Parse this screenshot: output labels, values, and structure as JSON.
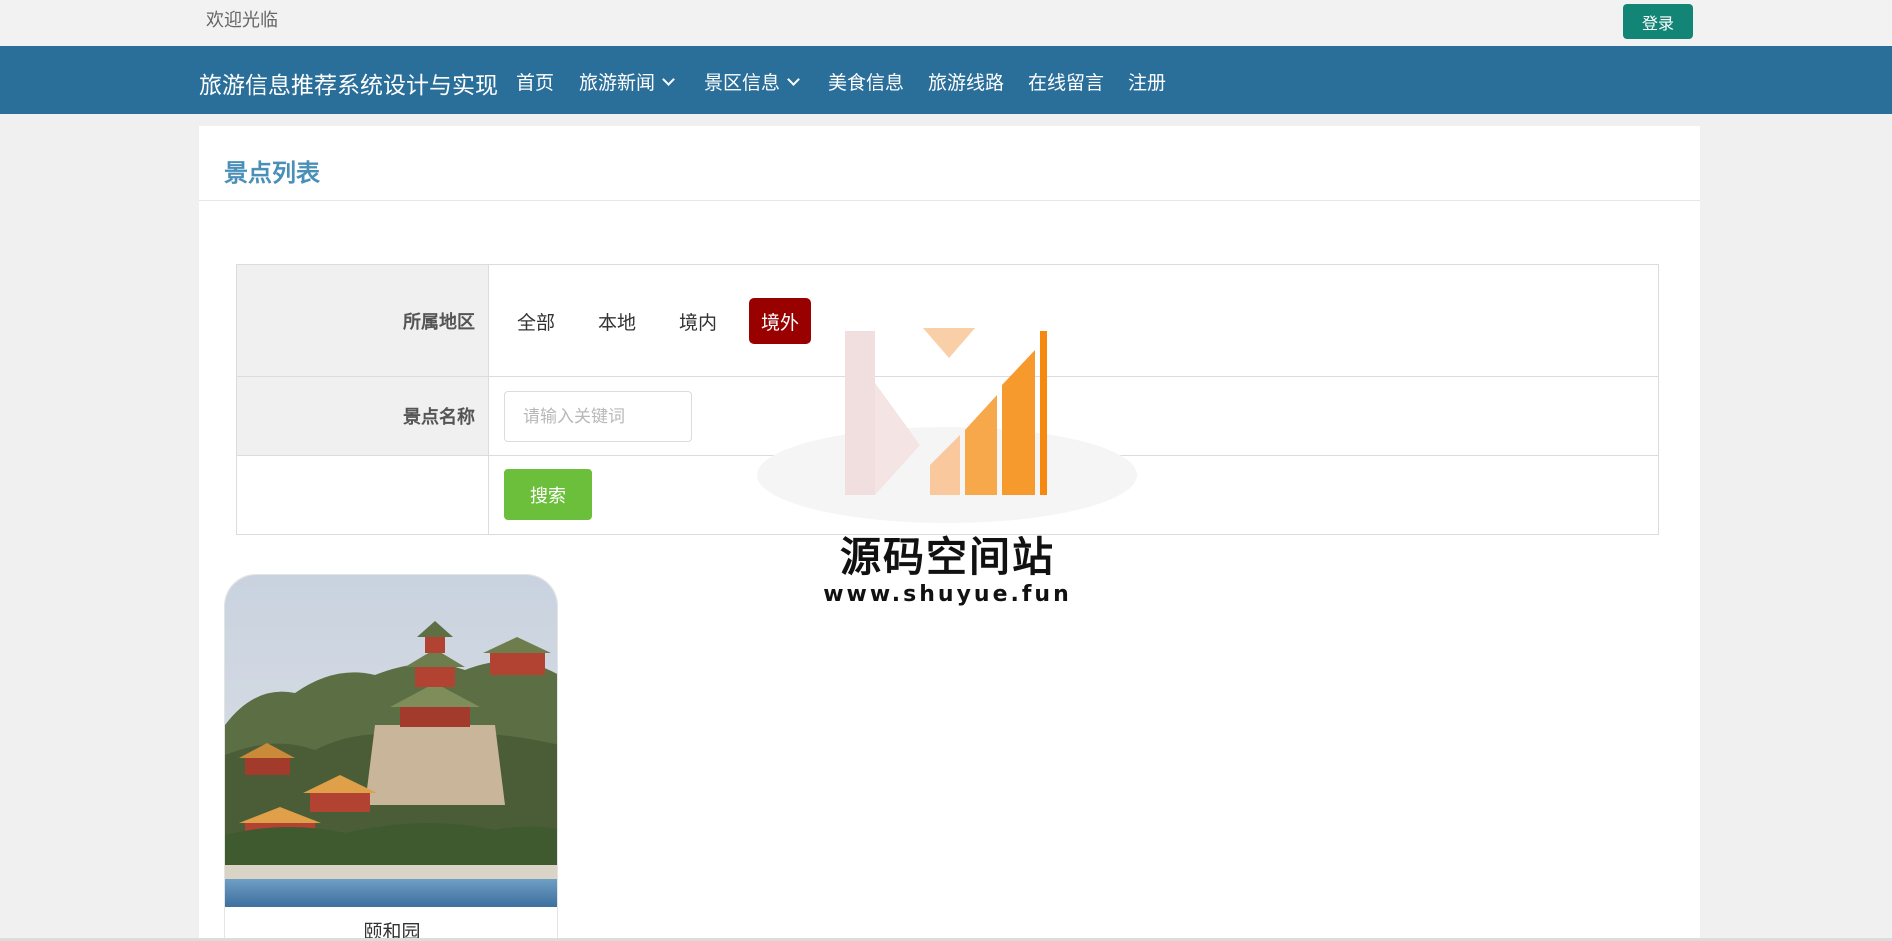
{
  "topbar": {
    "welcome": "欢迎光临",
    "login_label": "登录"
  },
  "navbar": {
    "brand": "旅游信息推荐系统设计与实现",
    "items": [
      {
        "label": "首页",
        "has_dropdown": false
      },
      {
        "label": "旅游新闻",
        "has_dropdown": true
      },
      {
        "label": "景区信息",
        "has_dropdown": true
      },
      {
        "label": "美食信息",
        "has_dropdown": false
      },
      {
        "label": "旅游线路",
        "has_dropdown": false
      },
      {
        "label": "在线留言",
        "has_dropdown": false
      },
      {
        "label": "注册",
        "has_dropdown": false
      }
    ]
  },
  "panel": {
    "title": "景点列表"
  },
  "filter": {
    "region_label": "所属地区",
    "regions": [
      "全部",
      "本地",
      "境内",
      "境外"
    ],
    "selected_region": "境外",
    "name_label": "景点名称",
    "name_placeholder": "请输入关键词",
    "name_value": "",
    "search_label": "搜索"
  },
  "cards": [
    {
      "name": "颐和园"
    }
  ],
  "watermark": {
    "title": "源码空间站",
    "url": "www.shuyue.fun"
  },
  "colors": {
    "navbar": "#2a6e9a",
    "login_button": "#138576",
    "selected_region": "#990000",
    "search_button": "#6bbf3a",
    "panel_title": "#4a8fb8"
  }
}
